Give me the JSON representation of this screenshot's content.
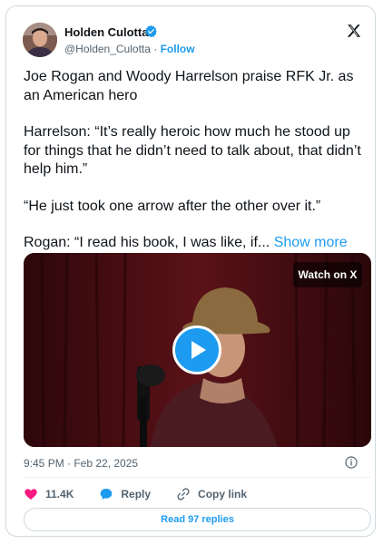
{
  "author": {
    "name": "Holden Culotta",
    "handle": "@Holden_Culotta",
    "follow_label": "Follow",
    "separator": "·"
  },
  "tweet": {
    "paragraphs": [
      "Joe Rogan and Woody Harrelson praise RFK Jr. as an American hero",
      "Harrelson: “It’s really heroic how much he stood up for things that he didn’t need to talk about, that didn’t help him.”",
      "“He just took one arrow after the other over it.”"
    ],
    "last_paragraph": "Rogan: “I read his book, I was like, if... ",
    "show_more": "Show more"
  },
  "media": {
    "watch_label": "Watch on X"
  },
  "timestamp": "9:45 PM · Feb 22, 2025",
  "actions": {
    "likes": "11.4K",
    "reply_label": "Reply",
    "copy_link_label": "Copy link"
  },
  "replies_button": "Read 97 replies",
  "colors": {
    "accent": "#1d9bf0",
    "like": "#f91880",
    "text": "#0f1419",
    "muted": "#536471"
  },
  "icons": [
    "verified-badge-icon",
    "x-logo-icon",
    "play-icon",
    "info-icon",
    "heart-icon",
    "reply-bubble-icon",
    "link-icon"
  ]
}
